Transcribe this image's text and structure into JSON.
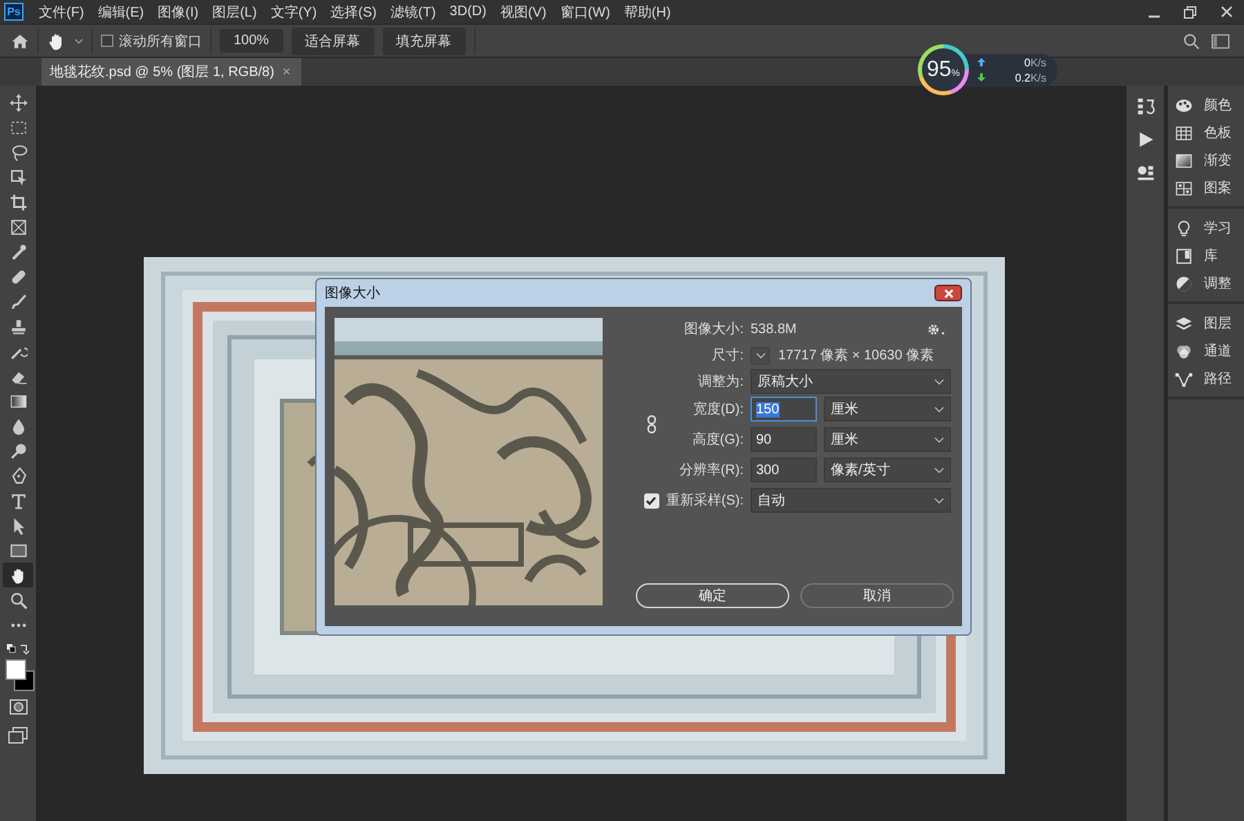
{
  "menu_bar": {
    "logo": "Ps",
    "items": [
      "文件(F)",
      "编辑(E)",
      "图像(I)",
      "图层(L)",
      "文字(Y)",
      "选择(S)",
      "滤镜(T)",
      "3D(D)",
      "视图(V)",
      "窗口(W)",
      "帮助(H)"
    ]
  },
  "options_bar": {
    "scroll_all_windows": {
      "label": "滚动所有窗口",
      "checked": false
    },
    "buttons": [
      "100%",
      "适合屏幕",
      "填充屏幕"
    ]
  },
  "document_tabs": [
    {
      "title": "地毯花纹.psd @ 5% (图层 1, RGB/8)",
      "close": "×",
      "selected": true
    }
  ],
  "network_monitor": {
    "percent": "95",
    "percent_sign": "%",
    "upload": "0",
    "upload_unit": "K/s",
    "download": "0.2",
    "download_unit": "K/s"
  },
  "toolbar": {
    "tools": [
      {
        "kind": "move",
        "selected": false
      },
      {
        "kind": "marquee",
        "selected": false
      },
      {
        "kind": "lasso",
        "selected": false
      },
      {
        "kind": "object-select",
        "selected": false
      },
      {
        "kind": "crop",
        "selected": false
      },
      {
        "kind": "frame",
        "selected": false
      },
      {
        "kind": "eyedropper",
        "selected": false
      },
      {
        "kind": "healing",
        "selected": false
      },
      {
        "kind": "brush",
        "selected": false
      },
      {
        "kind": "stamp",
        "selected": false
      },
      {
        "kind": "history-brush",
        "selected": false
      },
      {
        "kind": "eraser",
        "selected": false
      },
      {
        "kind": "gradient",
        "selected": false
      },
      {
        "kind": "blur",
        "selected": false
      },
      {
        "kind": "dodge",
        "selected": false
      },
      {
        "kind": "pen",
        "selected": false
      },
      {
        "kind": "type",
        "selected": false
      },
      {
        "kind": "path-select",
        "selected": false
      },
      {
        "kind": "shape",
        "selected": false
      },
      {
        "kind": "hand",
        "selected": true
      },
      {
        "kind": "zoom",
        "selected": false
      },
      {
        "kind": "more",
        "selected": false
      }
    ]
  },
  "side_strip": {
    "items": [
      {
        "kind": "history"
      },
      {
        "kind": "actions"
      },
      {
        "kind": "properties"
      }
    ]
  },
  "panels": {
    "groups": [
      {
        "items": [
          {
            "label": "颜色",
            "kind": "color"
          },
          {
            "label": "色板",
            "kind": "swatches"
          },
          {
            "label": "渐变",
            "kind": "gradients"
          },
          {
            "label": "图案",
            "kind": "patterns"
          }
        ]
      },
      {
        "items": [
          {
            "label": "学习",
            "kind": "learn"
          },
          {
            "label": "库",
            "kind": "libraries"
          },
          {
            "label": "调整",
            "kind": "adjustments"
          }
        ]
      },
      {
        "items": [
          {
            "label": "图层",
            "kind": "layers"
          },
          {
            "label": "通道",
            "kind": "channels"
          },
          {
            "label": "路径",
            "kind": "paths"
          }
        ]
      }
    ]
  },
  "dialog": {
    "title": "图像大小",
    "image_size": {
      "label": "图像大小:",
      "value": "538.8M"
    },
    "dimensions": {
      "label": "尺寸:",
      "value": "17717 像素 × 10630 像素"
    },
    "fit_to": {
      "label": "调整为:",
      "value": "原稿大小"
    },
    "width": {
      "label": "宽度(D):",
      "value": "150",
      "text_selected": true,
      "unit": "厘米"
    },
    "height": {
      "label": "高度(G):",
      "value": "90",
      "text_selected": false,
      "unit": "厘米"
    },
    "resolution": {
      "label": "分辨率(R):",
      "value": "300",
      "text_selected": false,
      "unit": "像素/英寸"
    },
    "resample": {
      "label": "重新采样(S):",
      "checked": true,
      "value": "自动"
    },
    "buttons": [
      {
        "label": "确定",
        "kind": "primary"
      },
      {
        "label": "取消",
        "kind": "secondary"
      }
    ]
  }
}
